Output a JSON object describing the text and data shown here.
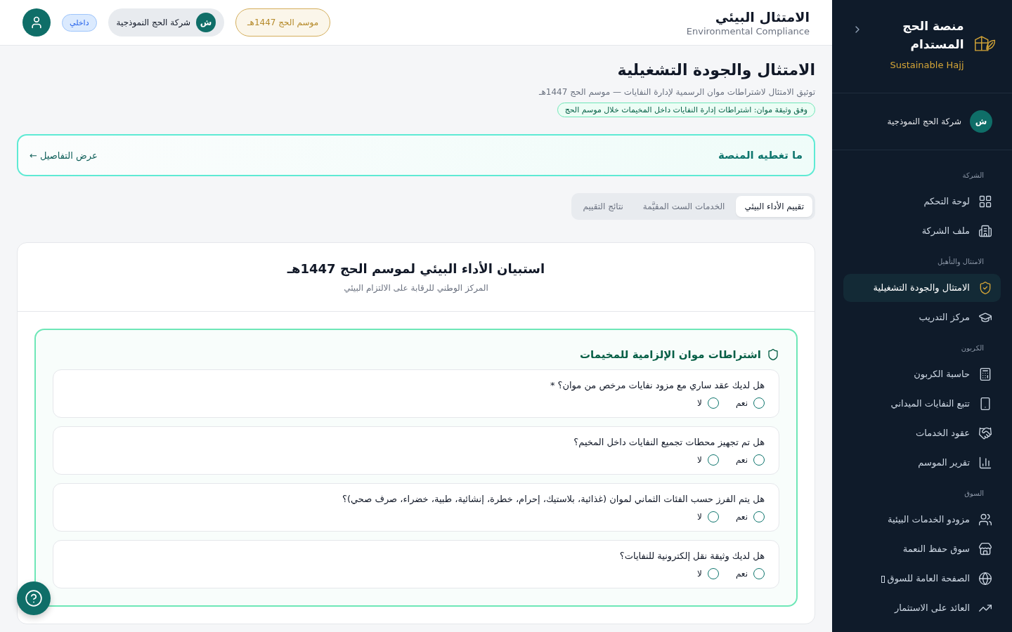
{
  "header": {
    "title": "الامتثال البيئي",
    "subtitle": "Environmental Compliance",
    "season": "موسم الحج 1447هـ",
    "company": {
      "initial": "ش",
      "name": "شركة الحج النموذجية"
    },
    "role_badge": "داخلي"
  },
  "sidebar": {
    "brand": {
      "title": "منصة الحج المستدام",
      "subtitle": "Sustainable Hajj"
    },
    "company": {
      "initial": "ش",
      "name": "شركة الحج النموذجية"
    },
    "groups": [
      {
        "label": "الشركة",
        "items": [
          {
            "label": "لوحة التحكم",
            "kind": "dashboard",
            "selected": false
          },
          {
            "label": "ملف الشركة",
            "kind": "building",
            "selected": false
          }
        ]
      },
      {
        "label": "الامتثال والتأهيل",
        "items": [
          {
            "label": "الامتثال والجودة التشغيلية",
            "kind": "shield",
            "selected": true
          },
          {
            "label": "مركز التدريب",
            "kind": "training",
            "selected": false
          }
        ]
      },
      {
        "label": "الكربون",
        "items": [
          {
            "label": "حاسبة الكربون",
            "kind": "calculator",
            "selected": false
          },
          {
            "label": "تتبع النفايات الميداني",
            "kind": "phone",
            "selected": false
          },
          {
            "label": "عقود الخدمات",
            "kind": "handshake",
            "selected": false
          },
          {
            "label": "تقرير الموسم",
            "kind": "chart",
            "selected": false
          }
        ]
      },
      {
        "label": "السوق",
        "items": [
          {
            "label": "مزودو الخدمات البيئية",
            "kind": "users",
            "selected": false
          },
          {
            "label": "سوق حفظ النعمة",
            "kind": "store",
            "selected": false
          },
          {
            "label": "الصفحة العامة للسوق",
            "kind": "globe",
            "selected": false,
            "external": true
          },
          {
            "label": "العائد على الاستثمار",
            "kind": "trend",
            "selected": false
          }
        ]
      }
    ]
  },
  "page": {
    "title": "الامتثال والجودة التشغيلية",
    "description": "توثيق الامتثال لاشتراطات موان الرسمية لإدارة النفايات — موسم الحج 1447هـ",
    "source_note": "وفق وثيقة موان: اشتراطات إدارة النفايات داخل المخيمات خلال موسم الحج"
  },
  "coverage": {
    "title": "ما تغطيه المنصة",
    "link": "عرض التفاصيل ←"
  },
  "tabs": [
    {
      "label": "تقييم الأداء البيئي",
      "selected": true
    },
    {
      "label": "الخدمات الست المقيَّمة",
      "selected": false
    },
    {
      "label": "نتائج التقييم",
      "selected": false
    }
  ],
  "survey": {
    "title": "استبيان الأداء البيئي لموسم الحج 1447هـ",
    "subtitle": "المركز الوطني للرقابة على الالتزام البيئي",
    "section": {
      "title": "اشتراطات موان الإلزامية للمخيمات",
      "questions": [
        {
          "text": "هل لديك عقد ساري مع مزود نفايات مرخص من موان؟ *",
          "options": [
            {
              "label": "نعم",
              "checked": false
            },
            {
              "label": "لا",
              "checked": false
            }
          ]
        },
        {
          "text": "هل تم تجهيز محطات تجميع النفايات داخل المخيم؟",
          "options": [
            {
              "label": "نعم",
              "checked": false
            },
            {
              "label": "لا",
              "checked": false
            }
          ]
        },
        {
          "text": "هل يتم الفرز حسب الفئات الثماني لموان (غذائية، بلاستيك، إحرام، خطرة، إنشائية، طبية، خضراء، صرف صحي)؟",
          "options": [
            {
              "label": "نعم",
              "checked": false
            },
            {
              "label": "لا",
              "checked": false
            }
          ]
        },
        {
          "text": "هل لديك وثيقة نقل إلكترونية للنفايات؟",
          "options": [
            {
              "label": "نعم",
              "checked": false
            },
            {
              "label": "لا",
              "checked": false
            }
          ]
        }
      ]
    }
  }
}
